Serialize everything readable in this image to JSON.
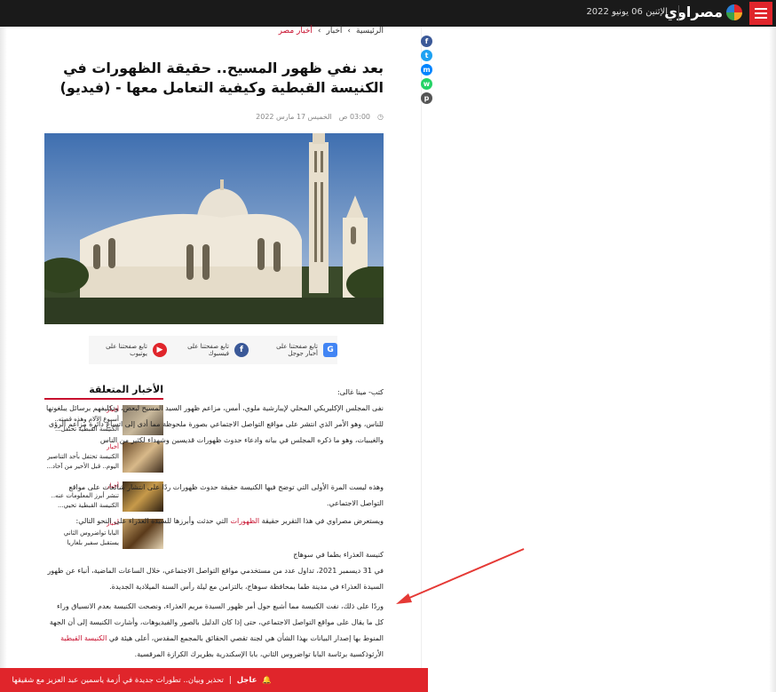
{
  "header": {
    "logo_text": "مصراوي",
    "date": "الإثنين 06 يونيو 2022",
    "accent": "#e0252b"
  },
  "breadcrumb": {
    "home": "الرئيسية",
    "news": "أخبار",
    "current": "أخبار مصر"
  },
  "article": {
    "title": "بعد نفي ظهور المسيح.. حقيقة الظهورات في الكنيسة القبطية وكيفية التعامل معها - (فيديو)",
    "time": "03:00 ص",
    "date": "الخميس 17 مارس 2022",
    "author": "كتب- مينا غالى:",
    "p1": "نفى المجلس الإكليريكي المحلي لإيبارشية ملوي، أمس، مزاعم ظهور السيد المسيح لبعض، وتكليفهم برسائل يبلغونها للناس، وهو الأمر الذي انتشر على مواقع التواصل الاجتماعي بصورة ملحوظة مما أدى إلى اتساع دائرة مزاعم الرؤى والغيبيات، وهو ما ذكره المجلس في بيانه وادعاء حدوث ظهورات قديسين وشهداء لكثير من الناس",
    "p2": "وهذه ليست المرة الأولى التي توضح فيها الكنيسة حقيقة حدوث ظهورات ردًا على انتشار شائعات على مواقع التواصل الاجتماعي.",
    "p3_a": "ويستعرض مصراوي في هذا التقرير حقيقة ",
    "p3_link": "الظهورات",
    "p3_b": " التي حدثت وأبرزها للسيدة العذراء على النحو التالي:",
    "subhead": "كنيسة العذراء بطما في سوهاج",
    "p4": "في 31 ديسمبر 2021، تداول عدد من مستخدمي مواقع التواصل الاجتماعي، خلال الساعات الماضية، أنباء عن ظهور السيدة العذراء في مدينة طما بمحافظة سوهاج، بالتزامن مع ليلة رأس السنة الميلادية الجديدة.",
    "p5_a": "وردًا على ذلك، نفت الكنيسة مما أشيع حول أمر ظهور السيدة مريم العذراء، ونصحت الكنيسة بعدم الانسياق وراء كل ما يقال على مواقع التواصل الاجتماعي، حتى إذا كان الدليل بالصور والفيديوهات، وأشارت الكنيسة إلى أن الجهة المنوط بها إصدار البيانات بهذا الشأن هي لجنة تقصي الحقائق بالمجمع المقدس، أعلى هيئة في ",
    "p5_link": "الكنيسة القبطية",
    "p5_b": " الأرثوذكسية برئاسة البابا تواضروس الثاني، بابا الإسكندرية بطريرك الكرازة المرقسية."
  },
  "follow": [
    {
      "label": "تابع صفحتنا على أخبار جوجل",
      "icon": "google-news-icon",
      "color": "#4285f4"
    },
    {
      "label": "تابع صفحتنا على فيسبوك",
      "icon": "facebook-icon",
      "color": "#3b5998"
    },
    {
      "label": "تابع صفحتنا على يوتيوب",
      "icon": "youtube-icon",
      "color": "#e0252b"
    }
  ],
  "related": {
    "title": "الأخبار المتعلقة",
    "items": [
      {
        "category": "أخبار",
        "text": "أسبوع الآلام وهذه قصته.. الكنيسة القبطية تحتفل..."
      },
      {
        "category": "أخبار",
        "text": "الكنيسة تحتفل بأحد التناصير اليوم.. قبل الأخير من آحاد..."
      },
      {
        "category": "أخبار",
        "text": "تنشر أبرز المعلومات عنه.. الكنيسة القبطية تحيي..."
      },
      {
        "category": "أخبار",
        "text": "البابا تواضروس الثاني يستقبل سفير بلغاريا"
      }
    ]
  },
  "ticker": {
    "label": "عاجل",
    "text": "تحذير وبيان.. تطورات جديدة في أزمة ياسمين عبد العزيز مع شقيقها"
  },
  "share_icons": [
    "facebook-icon",
    "twitter-icon",
    "messenger-icon",
    "whatsapp-icon",
    "print-icon"
  ]
}
